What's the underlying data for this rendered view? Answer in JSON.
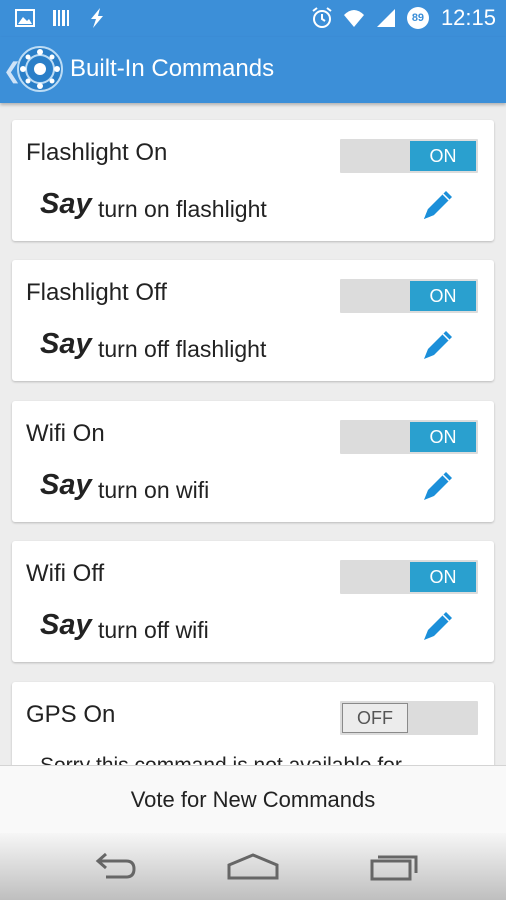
{
  "status_bar": {
    "time": "12:15",
    "battery_level": "89",
    "left_icons": [
      "image-icon",
      "barcode-icon",
      "flash-icon"
    ],
    "right_icons": [
      "alarm-icon",
      "wifi-icon",
      "signal-icon",
      "battery-icon"
    ]
  },
  "app_bar": {
    "title": "Built-In Commands",
    "back_icon": "chevron-left-icon",
    "logo_icon": "app-logo-icon"
  },
  "say_label": "Say",
  "commands": [
    {
      "title": "Flashlight On",
      "state": "ON",
      "phrase": "turn on flashlight"
    },
    {
      "title": "Flashlight Off",
      "state": "ON",
      "phrase": "turn off flashlight"
    },
    {
      "title": "Wifi On",
      "state": "ON",
      "phrase": "turn on wifi"
    },
    {
      "title": "Wifi Off",
      "state": "ON",
      "phrase": "turn off wifi"
    },
    {
      "title": "GPS On",
      "state": "OFF",
      "note": "Sorry this command is not available for"
    }
  ],
  "vote_button": "Vote for New Commands",
  "colors": {
    "primary": "#3c8fd8",
    "toggle_on": "#2aa0cf",
    "edit_icon": "#1b8fd9"
  },
  "nav_icons": [
    "back-icon",
    "home-icon",
    "recent-apps-icon"
  ]
}
